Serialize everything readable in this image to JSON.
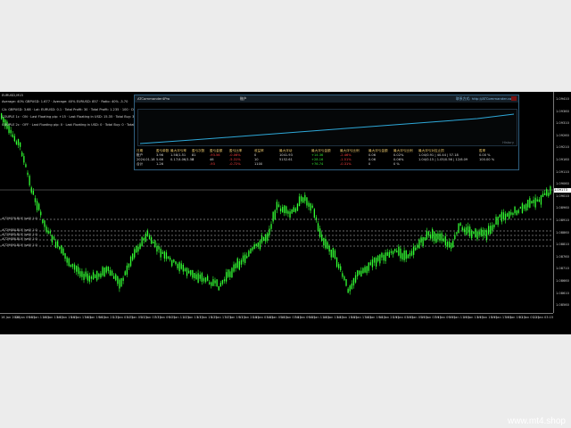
{
  "chart": {
    "symbol": "EURUSD,M15",
    "info_lines": [
      "Average: 40% GBPUSD: 1.677 · Average: 40% EURUSD: 857 · Ratio: 40% -3.70",
      "CA: GBPUSD: 3.68 · Lot: EURUSD: 0.1 · Total Profit: 30 · Total Profit: 1.235 · 100 · Drawdown · 300 · Maximum Lots: 0.75"
    ],
    "couple_lines": [
      "COUPLE 1c · ON · Last Floating pip: +15 · Last Floating in USD: 15.35 · Total Buy: 3.0 · Total Sell: 3.0",
      "COUPLE 2c · OFF · Last Floating pip: 0 · Last Floating in USD: 0 · Total Buy: 0 · Total Sell: 0"
    ],
    "level_labels": [
      "#729676-BUY (sell) 1:0",
      "#729684-BUY (sell) 1:0",
      "#729685-BUY (sell) 1:0",
      "#729686-BUY (sell) 1:0",
      "#729690-BUY (sell) 1:0"
    ],
    "price_ticks": [
      "1.09410",
      "1.09360",
      "1.09310",
      "1.09260",
      "1.09210",
      "1.09160",
      "1.09110",
      "1.09060",
      "1.09010",
      "1.08960",
      "1.08910",
      "1.08860",
      "1.08810",
      "1.08760",
      "1.08710",
      "1.08660",
      "1.08610",
      "1.08560"
    ],
    "current_price": "1.09173",
    "time_ticks": [
      "16 Jan 2024",
      "16 Jan 09:15",
      "16 Jan 11:15",
      "16 Jan 13:15",
      "16 Jan 15:15",
      "16 Jan 17:15",
      "16 Jan 19:15",
      "16 Jan 21:15",
      "17 Jan 03:15",
      "17 Jan 05:15",
      "17 Jan 07:15",
      "17 Jan 09:15",
      "17 Jan 11:15",
      "17 Jan 13:15",
      "17 Jan 15:15",
      "17 Jan 17:15",
      "17 Jan 19:15",
      "17 Jan 21:15",
      "18 Jan 03:15",
      "18 Jan 05:15",
      "18 Jan 07:15",
      "18 Jan 09:15",
      "18 Jan 11:15",
      "18 Jan 13:15",
      "18 Jan 15:15",
      "18 Jan 17:15",
      "18 Jan 19:15",
      "18 Jan 21:15",
      "19 Jan 03:15",
      "19 Jan 05:15",
      "19 Jan 07:15",
      "19 Jan 09:15",
      "19 Jan 11:15",
      "19 Jan 13:15",
      "19 Jan 15:15",
      "19 Jan 17:15",
      "19 Jan 19:15",
      "22 Jan 01:15",
      "22 Jan 03:15"
    ],
    "colors": {
      "candle": "#33ff33",
      "level_line": "#cfcfcf",
      "equity_line": "#2ea8d8"
    }
  },
  "panel": {
    "title": "ATCommander4Pro",
    "mid_label": "账户",
    "link": "联系方式: http://ATCommander.com",
    "tabs": [
      "Details",
      "Summary",
      "Trade History",
      "Maximum Lots"
    ],
    "equity_footer": "History",
    "headers": [
      "日期",
      "盈亏单数",
      "最大浮亏率",
      "盈亏次数",
      "盈亏金额",
      "盈亏比率",
      "收益率",
      "最大浮动",
      "最大浮亏金额",
      "最大浮亏比例",
      "最大浮亏金额",
      "最大浮亏比例",
      "最大浮亏对应止损",
      "胜率"
    ],
    "rows": [
      [
        "账户",
        "3.96",
        "1.58/1.51",
        "81",
        "-93.56",
        "-0.06%",
        "0",
        "1041.93",
        "+14.36",
        "-2.46%",
        "0.06",
        "0.02%",
        "1.04/0.91 | 40.44 | 57.18",
        "0.00 %"
      ],
      [
        "2024.01.18",
        "5.66",
        "0.17/4.06/1.53",
        "8",
        "46",
        "-5.31%",
        "10",
        "5152.61",
        "+28.16",
        "-1.51%",
        "0.06",
        "0.06%",
        "1.04/0.15 | 1.05/0.56 | 12/6.09",
        "100.00 %"
      ],
      [
        "合计",
        "1.26",
        "",
        "",
        "-93",
        "-0.72%",
        "1100",
        "",
        "+76.74",
        "-0.31%",
        "0",
        "0 %",
        "",
        ""
      ]
    ]
  },
  "watermark": "www.mt4.shop"
}
